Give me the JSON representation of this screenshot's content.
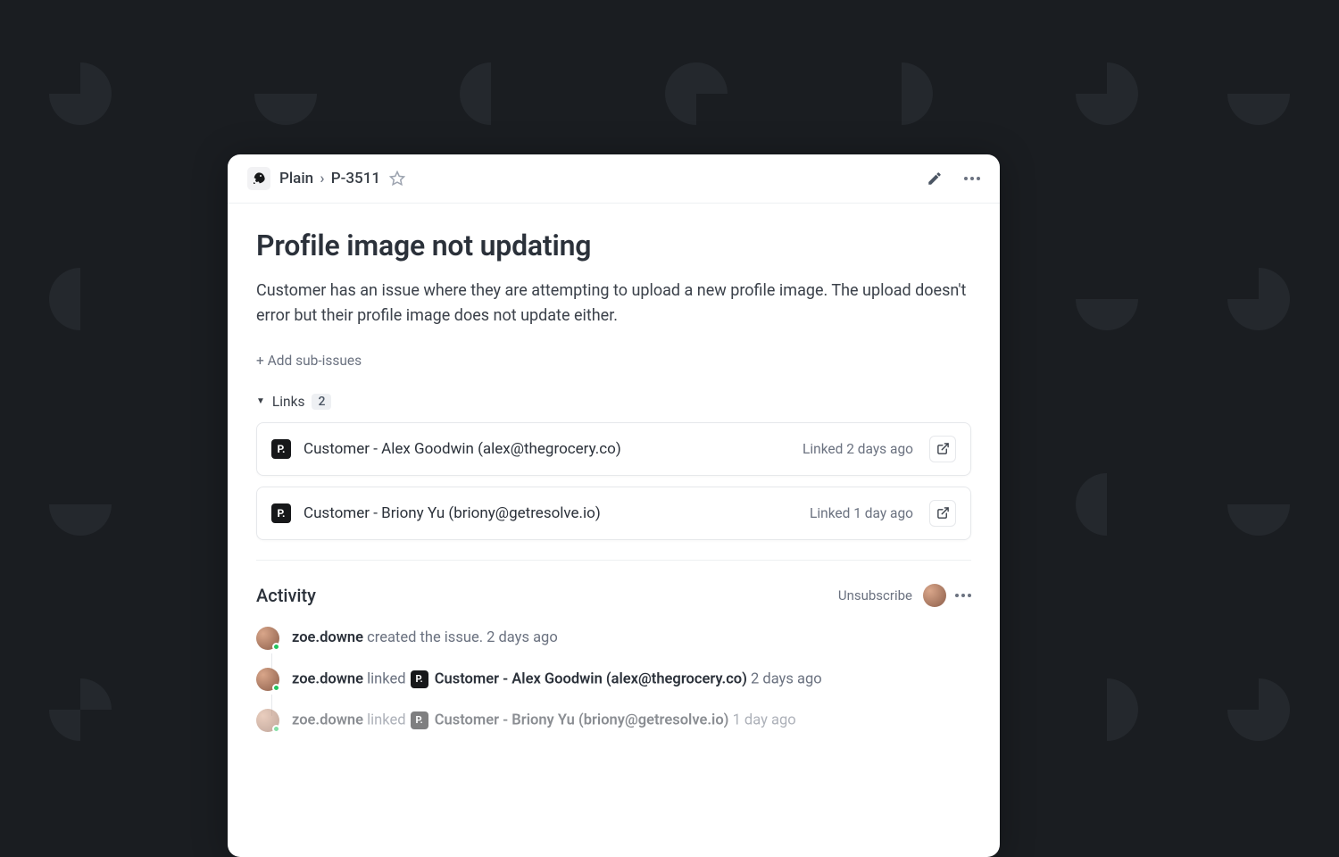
{
  "breadcrumb": {
    "project": "Plain",
    "id": "P-3511"
  },
  "issue": {
    "title": "Profile image not updating",
    "description": "Customer has an issue where they are attempting to upload a new profile image. The upload doesn't error but their profile image does not update either.",
    "add_sub_label": "+ Add sub-issues"
  },
  "links": {
    "label": "Links",
    "count": "2",
    "items": [
      {
        "badge": "P.",
        "title": "Customer - Alex Goodwin (alex@thegrocery.co)",
        "meta": "Linked 2 days ago"
      },
      {
        "badge": "P.",
        "title": "Customer - Briony Yu (briony@getresolve.io)",
        "meta": "Linked 1 day ago"
      }
    ]
  },
  "activity": {
    "label": "Activity",
    "unsubscribe_label": "Unsubscribe",
    "items": [
      {
        "user": "zoe.downe",
        "action": "created the issue.",
        "time": "2 days ago",
        "linked_badge": "",
        "linked_title": ""
      },
      {
        "user": "zoe.downe",
        "action": "linked",
        "linked_badge": "P.",
        "linked_title": "Customer - Alex Goodwin (alex@thegrocery.co)",
        "time": "2 days ago"
      },
      {
        "user": "zoe.downe",
        "action": "linked",
        "linked_badge": "P.",
        "linked_title": "Customer - Briony Yu (briony@getresolve.io)",
        "time": "1 day ago"
      }
    ]
  }
}
